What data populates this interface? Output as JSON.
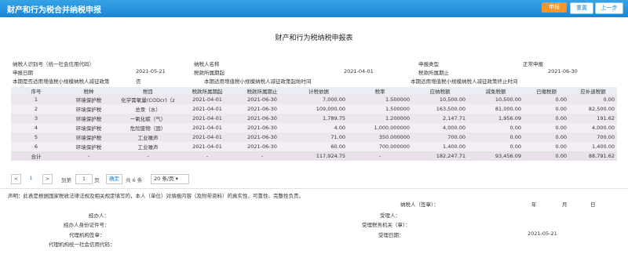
{
  "header": {
    "title": "财产和行为税合并纳税申报",
    "buttons": {
      "primary": "申报",
      "reset": "重置",
      "prev": "上一步"
    }
  },
  "form_title": "财产和行为税纳税申报表",
  "info": {
    "taxpayer_id_label": "纳税人识别号（统一社会信用代码）",
    "taxpayer_name_label": "纳税人名称",
    "declare_type_label": "申报类型",
    "declare_type_value": "正常申报",
    "declare_date_label": "申报日期",
    "declare_date_value": "2021-05-21",
    "period_start_label": "税款所属期起",
    "period_start_value": "2021-04-01",
    "period_end_label": "税款所属期止",
    "period_end_value": "2021-06-30",
    "small_scale_label": "本期是否适用增值税小规模纳税人减征政策",
    "small_scale_value": "否",
    "small_scale_start_label": "本期适用增值税小规模纳税人减征政策起始时间",
    "small_scale_end_label": "本期适用增值税小规模纳税人减征政策终止时间"
  },
  "table": {
    "headers": [
      "序号",
      "税种",
      "税目",
      "税款所属期起",
      "税款所属期止",
      "计税依据",
      "税率",
      "应纳税额",
      "减免税额",
      "已缴税额",
      "应补退税额"
    ],
    "rows": [
      [
        "1",
        "环境保护税",
        "化学需氧量(CODcr)（z",
        "2021-04-01",
        "2021-06-30",
        "7,000.00",
        "1.500000",
        "10,500.00",
        "10,500.00",
        "0.00",
        "0.00"
      ],
      [
        "2",
        "环境保护税",
        "总汞（水）",
        "2021-04-01",
        "2021-06-30",
        "109,000.00",
        "1.500000",
        "163,500.00",
        "81,000.00",
        "0.00",
        "82,500.00"
      ],
      [
        "3",
        "环境保护税",
        "一氧化碳（气）",
        "2021-04-01",
        "2021-06-30",
        "1,789.75",
        "1.200000",
        "2,147.71",
        "1,956.09",
        "0.00",
        "191.62"
      ],
      [
        "4",
        "环境保护税",
        "危险废物（固）",
        "2021-04-01",
        "2021-06-30",
        "4.00",
        "1,000.000000",
        "4,000.00",
        "0.00",
        "0.00",
        "4,000.00"
      ],
      [
        "5",
        "环境保护税",
        "工业噪声",
        "2021-04-01",
        "2021-06-30",
        "71.00",
        "350.000000",
        "700.00",
        "0.00",
        "0.00",
        "700.00"
      ],
      [
        "6",
        "环境保护税",
        "工业噪声",
        "2021-04-01",
        "2021-06-30",
        "60.00",
        "700.000000",
        "1,400.00",
        "0.00",
        "0.00",
        "1,400.00"
      ]
    ],
    "total": [
      "合计",
      "-",
      "-",
      "-",
      "-",
      "117,924.75",
      "-",
      "182,247.71",
      "93,456.09",
      "0.00",
      "88,791.62"
    ]
  },
  "pager": {
    "prev": "<",
    "page": "1",
    "next": ">",
    "goto_label": "到第",
    "goto_value": "1",
    "page_unit": "页",
    "confirm": "确定",
    "total": "共 6 条",
    "size": "20 条/页 ▾"
  },
  "declaration": "声明：此表是根据国家税收法律法规及相关规定填写的，本人（单位）对填报内容（及附带资料）的真实性、可靠性、完整性负责。",
  "signature": {
    "taxpayer_sign": "纳税人（签章）：",
    "year": "年",
    "month": "月",
    "day": "日",
    "handler": "经办人：",
    "handler_id": "经办人身份证件号：",
    "agency_sign": "代理机构签章：",
    "agency_code": "代理机构统一社会信用代码：",
    "receiver": "受理人：",
    "receiving_office": "受理税务机关（章）：",
    "receive_date_label": "受理日期：",
    "receive_date_value": "2021-05-21"
  }
}
